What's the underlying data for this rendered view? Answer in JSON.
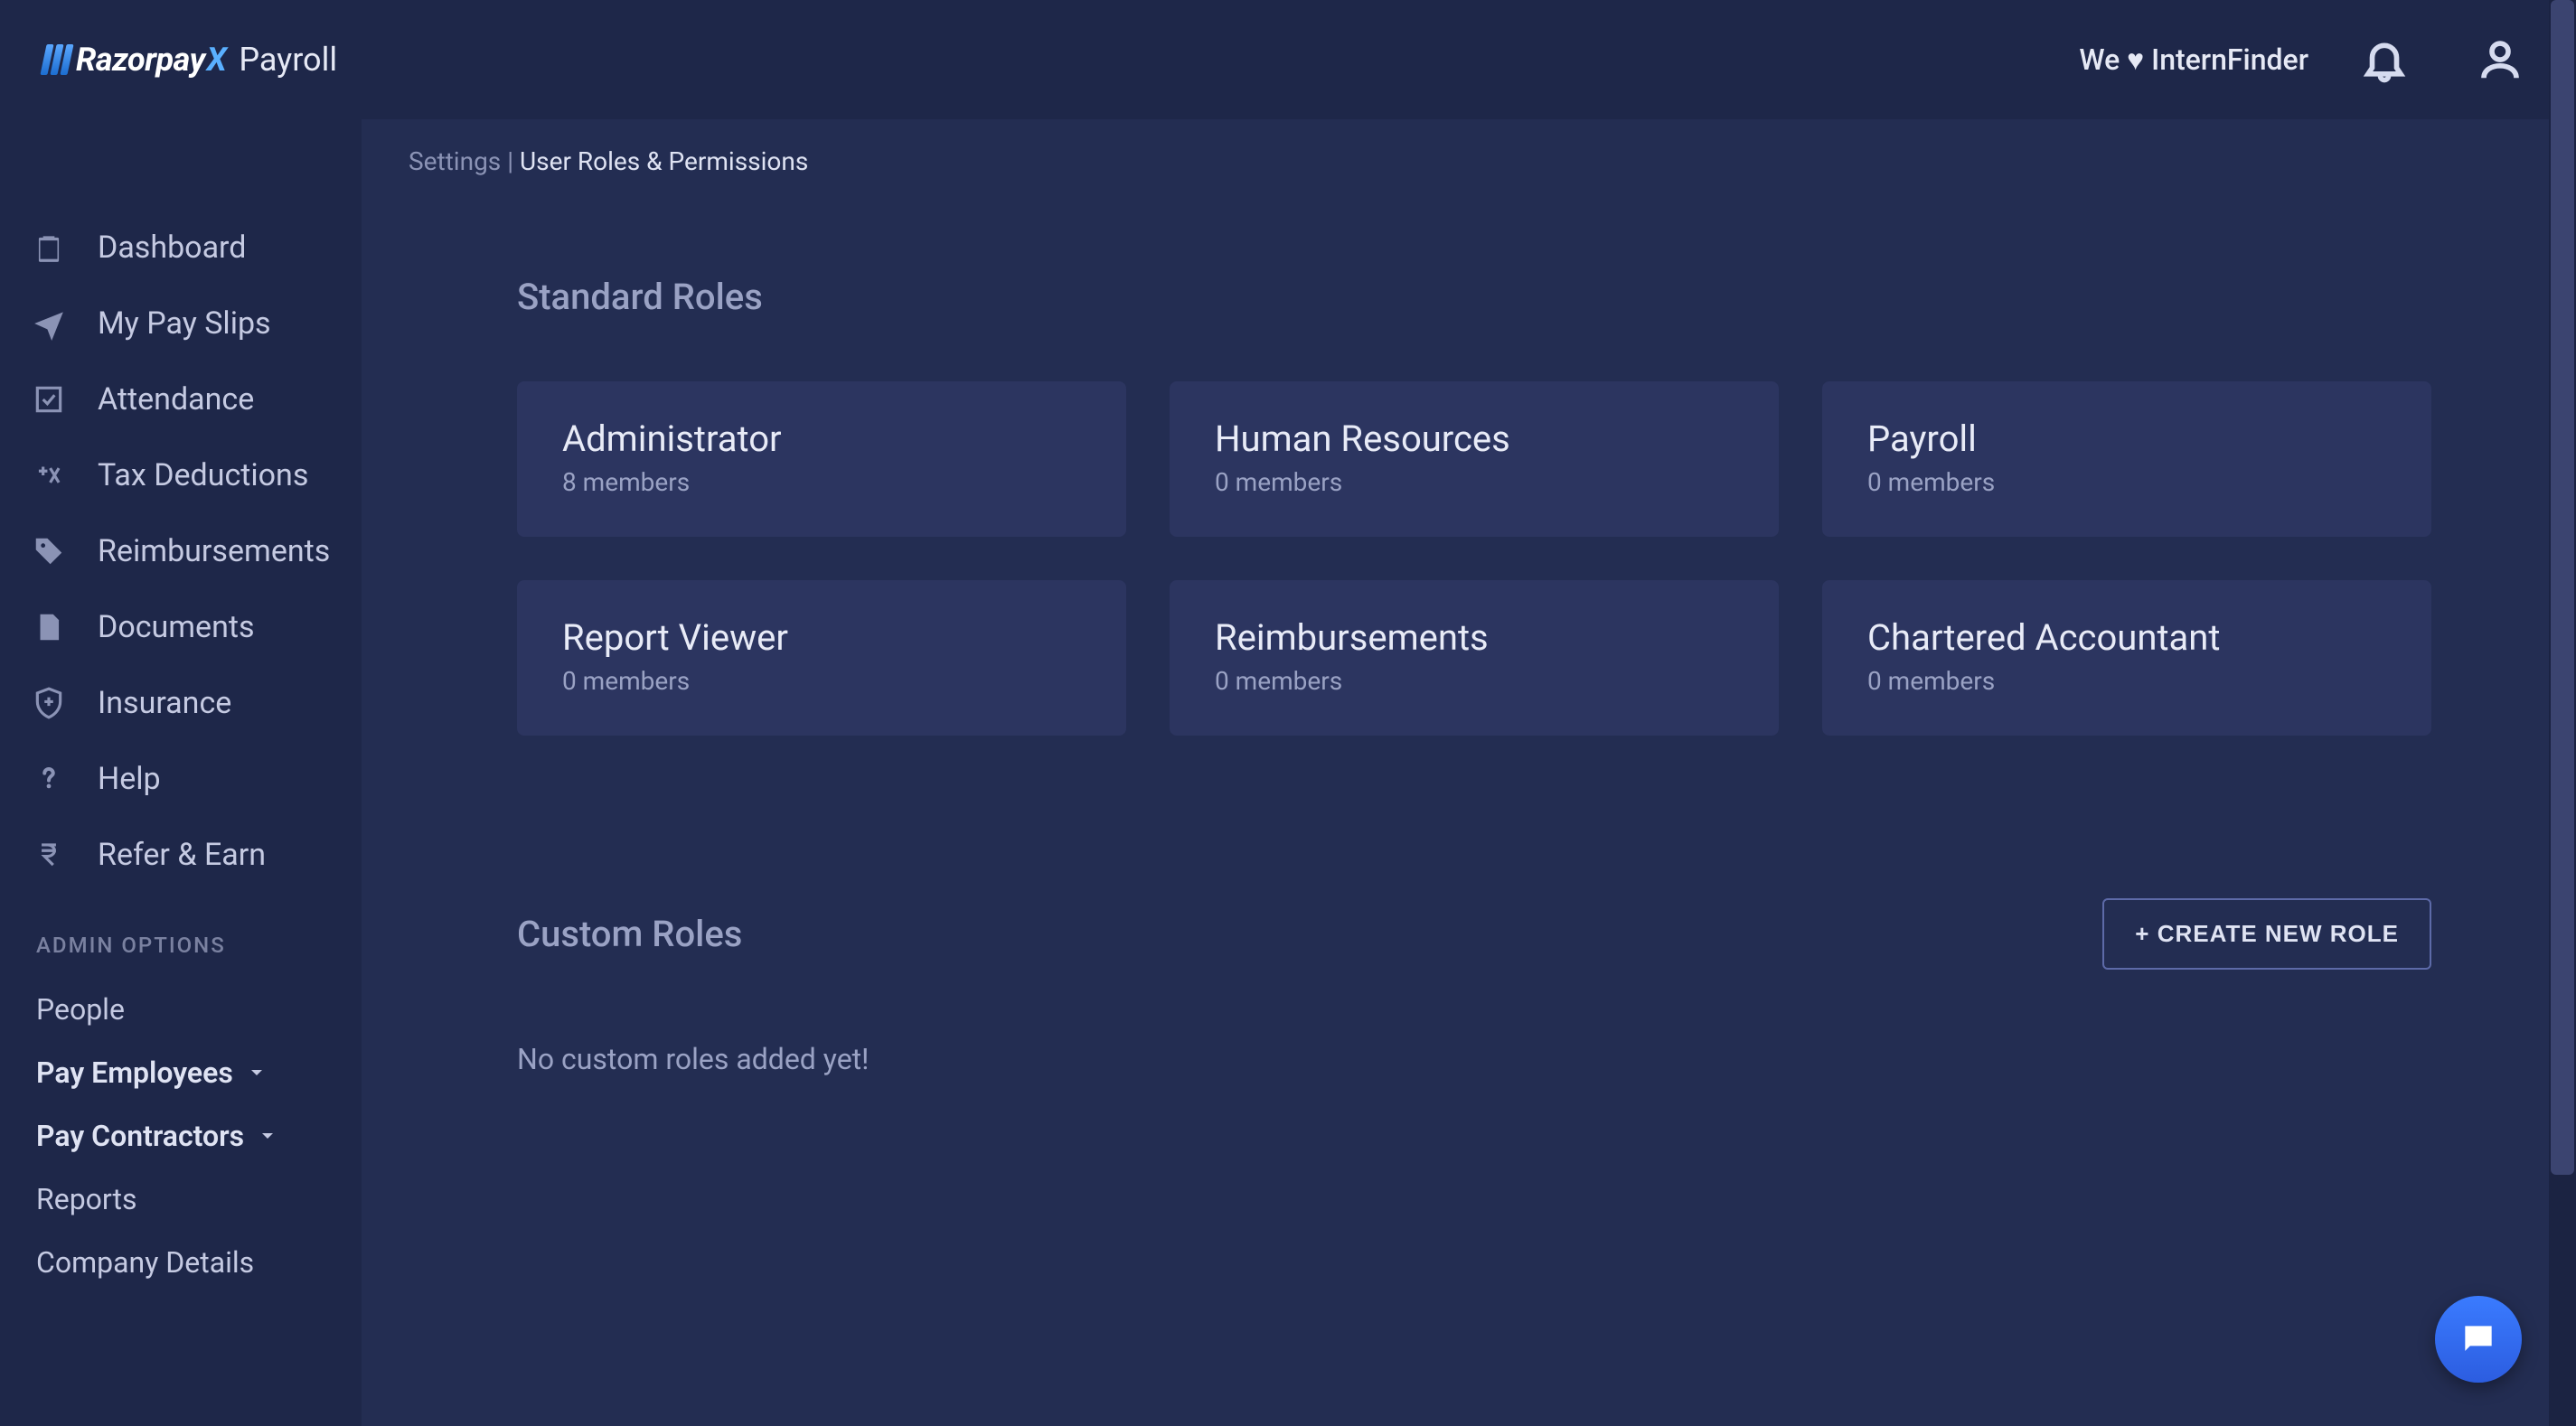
{
  "header": {
    "brand_main": "Razorpay",
    "brand_x": "X",
    "brand_sub": "Payroll",
    "org": "We ♥ InternFinder"
  },
  "breadcrumb": {
    "parent": "Settings",
    "separator": " | ",
    "current": "User Roles & Permissions"
  },
  "sidebar": {
    "items": [
      {
        "label": "Dashboard",
        "icon": "clipboard-icon"
      },
      {
        "label": "My Pay Slips",
        "icon": "paper-plane-icon"
      },
      {
        "label": "Attendance",
        "icon": "check-square-icon"
      },
      {
        "label": "Tax Deductions",
        "icon": "calc-icon"
      },
      {
        "label": "Reimbursements",
        "icon": "tag-icon"
      },
      {
        "label": "Documents",
        "icon": "document-icon"
      },
      {
        "label": "Insurance",
        "icon": "shield-plus-icon"
      },
      {
        "label": "Help",
        "icon": "question-icon"
      },
      {
        "label": "Refer & Earn",
        "icon": "rupee-icon"
      }
    ],
    "admin_section_label": "ADMIN OPTIONS",
    "admin_items": [
      {
        "label": "People",
        "expandable": false
      },
      {
        "label": "Pay Employees",
        "expandable": true
      },
      {
        "label": "Pay Contractors",
        "expandable": true
      },
      {
        "label": "Reports",
        "expandable": false
      },
      {
        "label": "Company Details",
        "expandable": false
      }
    ]
  },
  "standard_roles": {
    "title": "Standard Roles",
    "cards": [
      {
        "name": "Administrator",
        "members": "8 members"
      },
      {
        "name": "Human Resources",
        "members": "0 members"
      },
      {
        "name": "Payroll",
        "members": "0 members"
      },
      {
        "name": "Report Viewer",
        "members": "0 members"
      },
      {
        "name": "Reimbursements",
        "members": "0 members"
      },
      {
        "name": "Chartered Accountant",
        "members": "0 members"
      }
    ]
  },
  "custom_roles": {
    "title": "Custom Roles",
    "create_button": "+ CREATE NEW ROLE",
    "empty": "No custom roles added yet!"
  }
}
